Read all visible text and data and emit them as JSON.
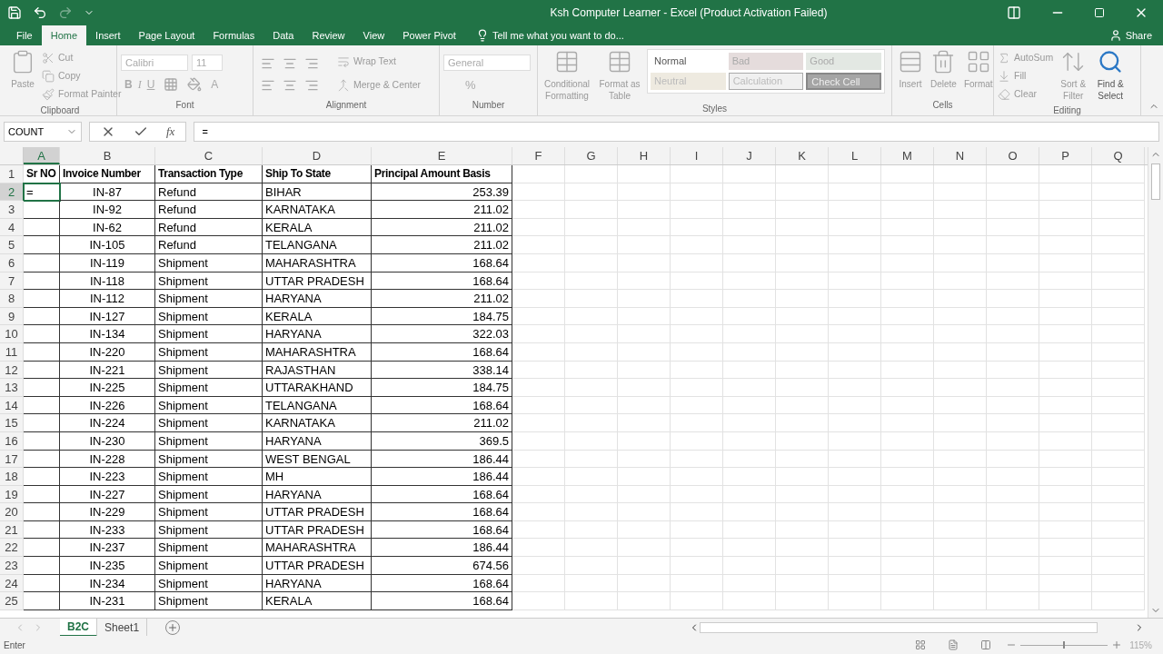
{
  "window": {
    "title": "Ksh Computer Learner - Excel (Product Activation Failed)"
  },
  "menu_tabs": [
    {
      "label": "File",
      "selected": false
    },
    {
      "label": "Home",
      "selected": true
    },
    {
      "label": "Insert",
      "selected": false
    },
    {
      "label": "Page Layout",
      "selected": false
    },
    {
      "label": "Formulas",
      "selected": false
    },
    {
      "label": "Data",
      "selected": false
    },
    {
      "label": "Review",
      "selected": false
    },
    {
      "label": "View",
      "selected": false
    },
    {
      "label": "Power Pivot",
      "selected": false
    }
  ],
  "tell_me": "Tell me what you want to do...",
  "share": "Share",
  "ribbon": {
    "clipboard": {
      "label": "Clipboard",
      "paste": "Paste",
      "cut": "Cut",
      "copy": "Copy",
      "format_painter": "Format Painter"
    },
    "font": {
      "label": "Font",
      "font_name": "Calibri",
      "font_size": "11",
      "bold": "B",
      "italic": "I",
      "underline": "U",
      "font_color": "A"
    },
    "alignment": {
      "label": "Alignment",
      "wrap_text": "Wrap Text",
      "merge_center": "Merge & Center"
    },
    "number": {
      "label": "Number",
      "format": "General",
      "percent": "%"
    },
    "styles": {
      "label": "Styles",
      "conditional_formatting": "Conditional Formatting",
      "format_as_table": "Format as Table",
      "cell_styles": [
        {
          "label": "Normal",
          "kind": "normal"
        },
        {
          "label": "Bad",
          "kind": "bad"
        },
        {
          "label": "Good",
          "kind": "good"
        },
        {
          "label": "Neutral",
          "kind": "neutral"
        },
        {
          "label": "Calculation",
          "kind": "calculation"
        },
        {
          "label": "Check Cell",
          "kind": "check"
        }
      ]
    },
    "cells": {
      "label": "Cells",
      "buttons": [
        "Insert",
        "Delete",
        "Format"
      ]
    },
    "editing": {
      "label": "Editing",
      "autosum": "AutoSum",
      "fill": "Fill",
      "clear": "Clear",
      "sort_filter": "Sort & Filter",
      "find_select": "Find & Select"
    }
  },
  "name_box": "COUNT",
  "formula": "=",
  "function_symbol": "fx",
  "zoom_slider": {
    "level": 0.5
  },
  "columns": [
    {
      "label": "A",
      "selected": true
    },
    {
      "label": "B",
      "selected": false
    },
    {
      "label": "C",
      "selected": false
    },
    {
      "label": "D",
      "selected": false
    },
    {
      "label": "E",
      "selected": false
    },
    {
      "label": "F",
      "selected": false
    },
    {
      "label": "G",
      "selected": false
    },
    {
      "label": "H",
      "selected": false
    },
    {
      "label": "I",
      "selected": false
    },
    {
      "label": "J",
      "selected": false
    },
    {
      "label": "K",
      "selected": false
    },
    {
      "label": "L",
      "selected": false
    },
    {
      "label": "M",
      "selected": false
    },
    {
      "label": "N",
      "selected": false
    },
    {
      "label": "O",
      "selected": false
    },
    {
      "label": "P",
      "selected": false
    },
    {
      "label": "Q",
      "selected": false
    }
  ],
  "rows": [
    {
      "number": "1",
      "kind": "header",
      "cells": [
        "Sr NO",
        "Invoice Number",
        "Transaction Type",
        "Ship To State",
        "Principal Amount Basis"
      ],
      "selected": false
    },
    {
      "number": "2",
      "kind": "data",
      "cells": [
        "=",
        "IN-87",
        "Refund",
        "BIHAR",
        "253.39"
      ],
      "selected": true
    },
    {
      "number": "3",
      "kind": "data",
      "cells": [
        "",
        "IN-92",
        "Refund",
        "KARNATAKA",
        "211.02"
      ],
      "selected": false
    },
    {
      "number": "4",
      "kind": "data",
      "cells": [
        "",
        "IN-62",
        "Refund",
        "KERALA",
        "211.02"
      ],
      "selected": false
    },
    {
      "number": "5",
      "kind": "data",
      "cells": [
        "",
        "IN-105",
        "Refund",
        "TELANGANA",
        "211.02"
      ],
      "selected": false
    },
    {
      "number": "6",
      "kind": "data",
      "cells": [
        "",
        "IN-119",
        "Shipment",
        "MAHARASHTRA",
        "168.64"
      ],
      "selected": false
    },
    {
      "number": "7",
      "kind": "data",
      "cells": [
        "",
        "IN-118",
        "Shipment",
        "UTTAR PRADESH",
        "168.64"
      ],
      "selected": false
    },
    {
      "number": "8",
      "kind": "data",
      "cells": [
        "",
        "IN-112",
        "Shipment",
        "HARYANA",
        "211.02"
      ],
      "selected": false
    },
    {
      "number": "9",
      "kind": "data",
      "cells": [
        "",
        "IN-127",
        "Shipment",
        "KERALA",
        "184.75"
      ],
      "selected": false
    },
    {
      "number": "10",
      "kind": "data",
      "cells": [
        "",
        "IN-134",
        "Shipment",
        "HARYANA",
        "322.03"
      ],
      "selected": false
    },
    {
      "number": "11",
      "kind": "data",
      "cells": [
        "",
        "IN-220",
        "Shipment",
        "MAHARASHTRA",
        "168.64"
      ],
      "selected": false
    },
    {
      "number": "12",
      "kind": "data",
      "cells": [
        "",
        "IN-221",
        "Shipment",
        "RAJASTHAN",
        "338.14"
      ],
      "selected": false
    },
    {
      "number": "13",
      "kind": "data",
      "cells": [
        "",
        "IN-225",
        "Shipment",
        "UTTARAKHAND",
        "184.75"
      ],
      "selected": false
    },
    {
      "number": "14",
      "kind": "data",
      "cells": [
        "",
        "IN-226",
        "Shipment",
        "TELANGANA",
        "168.64"
      ],
      "selected": false
    },
    {
      "number": "15",
      "kind": "data",
      "cells": [
        "",
        "IN-224",
        "Shipment",
        "KARNATAKA",
        "211.02"
      ],
      "selected": false
    },
    {
      "number": "16",
      "kind": "data",
      "cells": [
        "",
        "IN-230",
        "Shipment",
        "HARYANA",
        "369.5"
      ],
      "selected": false
    },
    {
      "number": "17",
      "kind": "data",
      "cells": [
        "",
        "IN-228",
        "Shipment",
        "WEST BENGAL",
        "186.44"
      ],
      "selected": false
    },
    {
      "number": "18",
      "kind": "data",
      "cells": [
        "",
        "IN-223",
        "Shipment",
        "MH",
        "186.44"
      ],
      "selected": false
    },
    {
      "number": "19",
      "kind": "data",
      "cells": [
        "",
        "IN-227",
        "Shipment",
        "HARYANA",
        "168.64"
      ],
      "selected": false
    },
    {
      "number": "20",
      "kind": "data",
      "cells": [
        "",
        "IN-229",
        "Shipment",
        "UTTAR PRADESH",
        "168.64"
      ],
      "selected": false
    },
    {
      "number": "21",
      "kind": "data",
      "cells": [
        "",
        "IN-233",
        "Shipment",
        "UTTAR PRADESH",
        "168.64"
      ],
      "selected": false
    },
    {
      "number": "22",
      "kind": "data",
      "cells": [
        "",
        "IN-237",
        "Shipment",
        "MAHARASHTRA",
        "186.44"
      ],
      "selected": false
    },
    {
      "number": "23",
      "kind": "data",
      "cells": [
        "",
        "IN-235",
        "Shipment",
        "UTTAR PRADESH",
        "674.56"
      ],
      "selected": false
    },
    {
      "number": "24",
      "kind": "data",
      "cells": [
        "",
        "IN-234",
        "Shipment",
        "HARYANA",
        "168.64"
      ],
      "selected": false
    },
    {
      "number": "25",
      "kind": "data",
      "cells": [
        "",
        "IN-231",
        "Shipment",
        "KERALA",
        "168.64"
      ],
      "selected": false
    }
  ],
  "sheet_tabs": [
    {
      "label": "B2C",
      "selected": true
    },
    {
      "label": "Sheet1",
      "selected": false
    }
  ],
  "status_bar": {
    "mode": "Enter",
    "zoom": "115%"
  }
}
